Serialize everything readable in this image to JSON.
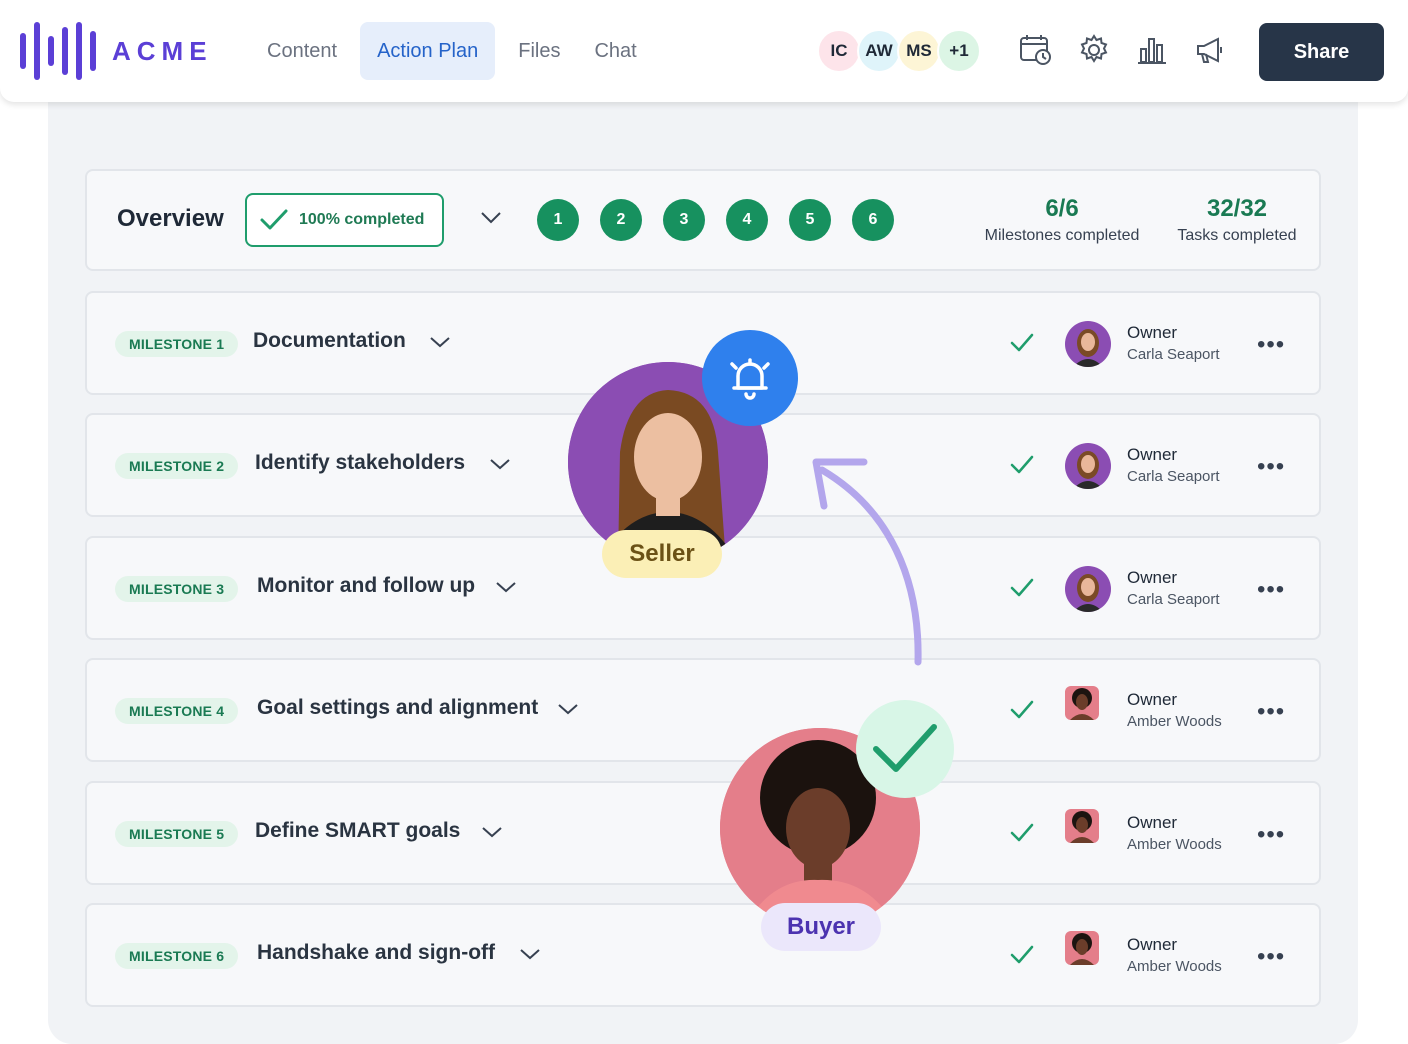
{
  "brand": {
    "name": "ACME",
    "color": "#5b3fd6"
  },
  "nav": {
    "items": [
      "Content",
      "Action Plan",
      "Files",
      "Chat"
    ],
    "active": "Action Plan"
  },
  "collaborators": [
    {
      "initials": "IC",
      "color": "#fde4ea"
    },
    {
      "initials": "AW",
      "color": "#dff4fa"
    },
    {
      "initials": "MS",
      "color": "#fdf5d6"
    },
    {
      "initials": "+1",
      "color": "#dcf5e5"
    }
  ],
  "toolbar": {
    "icons": [
      "calendar-clock-icon",
      "gear-icon",
      "bar-chart-icon",
      "megaphone-icon"
    ],
    "share_label": "Share"
  },
  "overview": {
    "title": "Overview",
    "completion_label": "100% completed",
    "steps": [
      "1",
      "2",
      "3",
      "4",
      "5",
      "6"
    ],
    "milestones_value": "6/6",
    "milestones_label": "Milestones completed",
    "tasks_value": "32/32",
    "tasks_label": "Tasks completed"
  },
  "milestones": [
    {
      "tag": "MILESTONE 1",
      "title": "Documentation",
      "owner_label": "Owner",
      "owner": "Carla Seaport"
    },
    {
      "tag": "MILESTONE 2",
      "title": "Identify stakeholders",
      "owner_label": "Owner",
      "owner": "Carla Seaport"
    },
    {
      "tag": "MILESTONE 3",
      "title": "Monitor and follow up",
      "owner_label": "Owner",
      "owner": "Carla Seaport"
    },
    {
      "tag": "MILESTONE 4",
      "title": "Goal settings and alignment",
      "owner_label": "Owner",
      "owner": "Amber Woods"
    },
    {
      "tag": "MILESTONE 5",
      "title": "Define SMART goals",
      "owner_label": "Owner",
      "owner": "Amber Woods"
    },
    {
      "tag": "MILESTONE 6",
      "title": "Handshake and sign-off",
      "owner_label": "Owner",
      "owner": "Amber Woods"
    }
  ],
  "overlays": {
    "seller_label": "Seller",
    "buyer_label": "Buyer"
  },
  "colors": {
    "accent_green": "#17915f",
    "share_bg": "#273548",
    "bell_blue": "#2f80ed",
    "arrow_lavender": "#b3a6ec"
  }
}
